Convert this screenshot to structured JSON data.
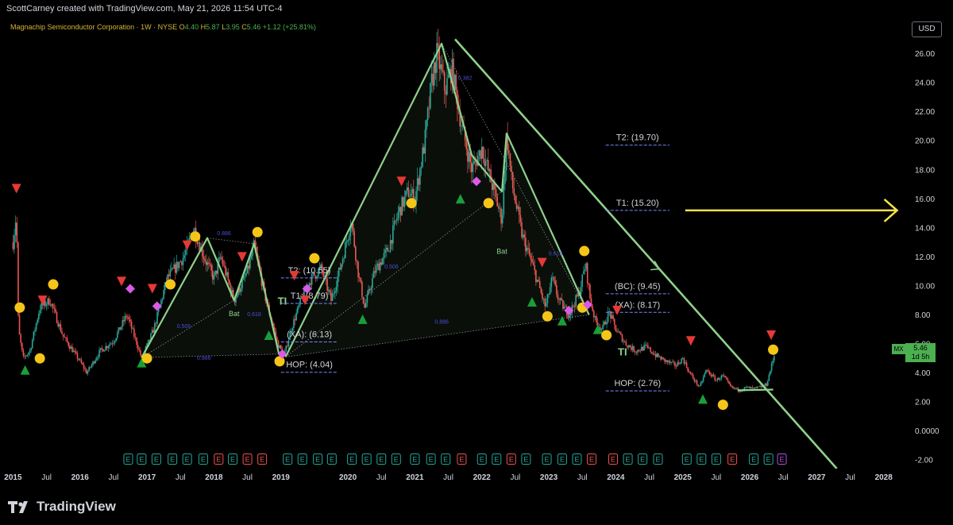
{
  "header": {
    "attribution": "ScottCarney created with TradingView.com, May 21, 2026 11:54 UTC-4"
  },
  "legend": {
    "title": "Magnachip Semiconductor Corporation · 1W · NYSE",
    "o_label": "O",
    "o_value": "4.40",
    "h_label": "H",
    "h_value": "5.87",
    "l_label": "L",
    "l_value": "3.95",
    "c_label": "C",
    "c_value": "5.46",
    "change": "+1.12 (+25.81%)"
  },
  "currency_button": "USD",
  "price_tag": {
    "symbol": "MX",
    "price": "5.46",
    "countdown": "1d 5h"
  },
  "footer": {
    "brand": "TradingView"
  },
  "colors": {
    "up": "#26a69a",
    "down": "#ef5350",
    "pattern": "#8fd18a",
    "arrow": "#f3e24a",
    "bull_marker": "#1b9e3a",
    "bear_marker": "#e53935",
    "circle": "#f5c518",
    "diamond": "#d95ae6"
  },
  "chart_data": {
    "type": "candlestick",
    "x_ticks": [
      "2015",
      "Jul",
      "2016",
      "Jul",
      "2017",
      "Jul",
      "2018",
      "Jul",
      "2019",
      "2020",
      "Jul",
      "2021",
      "Jul",
      "2022",
      "Jul",
      "2023",
      "Jul",
      "2024",
      "Jul",
      "2025",
      "Jul",
      "2026",
      "Jul",
      "2027",
      "Jul",
      "2028"
    ],
    "x_tick_years": [
      2015.0,
      2015.5,
      2016.0,
      2016.5,
      2017.0,
      2017.5,
      2018.0,
      2018.5,
      2019.0,
      2020.0,
      2020.5,
      2021.0,
      2021.5,
      2022.0,
      2022.5,
      2023.0,
      2023.5,
      2024.0,
      2024.5,
      2025.0,
      2025.5,
      2026.0,
      2026.5,
      2027.0,
      2027.5,
      2028.0
    ],
    "y_ticks": [
      "26.00",
      "24.00",
      "22.00",
      "20.00",
      "18.00",
      "16.00",
      "14.00",
      "12.00",
      "10.00",
      "8.00",
      "6.00",
      "4.00",
      "2.00",
      "0.0000",
      "-2.00"
    ],
    "y_tick_values": [
      26,
      24,
      22,
      20,
      18,
      16,
      14,
      12,
      10,
      8,
      6,
      4,
      2,
      0,
      -2
    ],
    "ylim": [
      -2.6,
      28.5
    ],
    "xlim": [
      2014.9,
      2028.3
    ],
    "price_path": [
      [
        2015.0,
        13.0
      ],
      [
        2015.05,
        15.0
      ],
      [
        2015.08,
        7.0
      ],
      [
        2015.15,
        5.0
      ],
      [
        2015.25,
        5.5
      ],
      [
        2015.4,
        8.5
      ],
      [
        2015.55,
        9.0
      ],
      [
        2015.75,
        6.5
      ],
      [
        2016.0,
        4.8
      ],
      [
        2016.1,
        4.0
      ],
      [
        2016.3,
        5.5
      ],
      [
        2016.5,
        6.2
      ],
      [
        2016.7,
        8.0
      ],
      [
        2016.85,
        6.0
      ],
      [
        2016.92,
        5.0
      ],
      [
        2017.1,
        7.0
      ],
      [
        2017.3,
        10.5
      ],
      [
        2017.55,
        12.0
      ],
      [
        2017.7,
        14.0
      ],
      [
        2017.85,
        12.0
      ],
      [
        2018.0,
        10.5
      ],
      [
        2018.1,
        12.0
      ],
      [
        2018.3,
        9.0
      ],
      [
        2018.5,
        11.0
      ],
      [
        2018.6,
        12.8
      ],
      [
        2018.75,
        9.5
      ],
      [
        2018.95,
        6.0
      ],
      [
        2019.05,
        5.2
      ],
      [
        2019.15,
        7.0
      ],
      [
        2019.3,
        9.0
      ],
      [
        2019.45,
        10.5
      ],
      [
        2019.6,
        11.2
      ],
      [
        2019.75,
        9.0
      ],
      [
        2019.9,
        11.5
      ],
      [
        2020.05,
        14.5
      ],
      [
        2020.15,
        11.0
      ],
      [
        2020.25,
        8.5
      ],
      [
        2020.4,
        11.0
      ],
      [
        2020.6,
        12.5
      ],
      [
        2020.75,
        15.0
      ],
      [
        2020.9,
        16.5
      ],
      [
        2021.0,
        16.0
      ],
      [
        2021.15,
        20.0
      ],
      [
        2021.25,
        24.0
      ],
      [
        2021.33,
        26.0
      ],
      [
        2021.45,
        23.5
      ],
      [
        2021.55,
        25.0
      ],
      [
        2021.7,
        21.0
      ],
      [
        2021.85,
        18.0
      ],
      [
        2022.0,
        19.5
      ],
      [
        2022.15,
        17.0
      ],
      [
        2022.3,
        14.5
      ],
      [
        2022.37,
        20.5
      ],
      [
        2022.45,
        17.0
      ],
      [
        2022.6,
        13.5
      ],
      [
        2022.75,
        11.5
      ],
      [
        2022.85,
        10.0
      ],
      [
        2022.95,
        8.5
      ],
      [
        2023.05,
        10.5
      ],
      [
        2023.15,
        9.0
      ],
      [
        2023.3,
        8.0
      ],
      [
        2023.45,
        9.5
      ],
      [
        2023.55,
        11.5
      ],
      [
        2023.62,
        9.0
      ],
      [
        2023.7,
        7.5
      ],
      [
        2023.8,
        7.0
      ],
      [
        2023.9,
        8.2
      ],
      [
        2024.0,
        7.0
      ],
      [
        2024.15,
        6.0
      ],
      [
        2024.3,
        5.5
      ],
      [
        2024.45,
        5.8
      ],
      [
        2024.6,
        5.2
      ],
      [
        2024.75,
        4.8
      ],
      [
        2024.9,
        4.5
      ],
      [
        2025.0,
        5.0
      ],
      [
        2025.1,
        4.0
      ],
      [
        2025.25,
        3.0
      ],
      [
        2025.35,
        4.2
      ],
      [
        2025.5,
        3.5
      ],
      [
        2025.6,
        3.8
      ],
      [
        2025.72,
        3.0
      ],
      [
        2025.85,
        2.8
      ],
      [
        2025.95,
        3.0
      ],
      [
        2026.05,
        2.9
      ],
      [
        2026.15,
        3.0
      ],
      [
        2026.25,
        3.2
      ],
      [
        2026.32,
        4.4
      ],
      [
        2026.38,
        5.46
      ]
    ],
    "pattern_lines": [
      [
        [
          2016.92,
          5.05
        ],
        [
          2017.9,
          13.3
        ],
        [
          2018.3,
          9.0
        ],
        [
          2018.6,
          12.9
        ],
        [
          2018.97,
          5.3
        ]
      ],
      [
        [
          2019.07,
          5.1
        ],
        [
          2021.4,
          26.7
        ],
        [
          2021.85,
          19.0
        ],
        [
          2022.3,
          16.5
        ],
        [
          2022.37,
          20.5
        ],
        [
          2023.6,
          8.0
        ]
      ],
      [
        [
          2025.82,
          2.8
        ],
        [
          2026.35,
          2.85
        ]
      ]
    ],
    "dotted_lines": [
      [
        [
          2016.92,
          5.05
        ],
        [
          2018.97,
          5.3
        ]
      ],
      [
        [
          2016.92,
          5.05
        ],
        [
          2018.3,
          9.0
        ]
      ],
      [
        [
          2017.9,
          13.3
        ],
        [
          2018.6,
          12.9
        ]
      ],
      [
        [
          2019.07,
          5.1
        ],
        [
          2022.3,
          16.5
        ]
      ],
      [
        [
          2019.07,
          5.1
        ],
        [
          2023.6,
          8.0
        ]
      ],
      [
        [
          2021.4,
          26.7
        ],
        [
          2023.6,
          8.0
        ]
      ]
    ],
    "trendline": [
      [
        2021.6,
        27.0
      ],
      [
        2027.3,
        -2.6
      ]
    ],
    "xabcd_ratios": [
      {
        "label": "0.886",
        "x": 2018.15,
        "y": 13.5
      },
      {
        "label": "0.506",
        "x": 2017.55,
        "y": 7.1
      },
      {
        "label": "0.618",
        "x": 2018.6,
        "y": 7.9
      },
      {
        "label": "0.886",
        "x": 2017.85,
        "y": 4.9
      },
      {
        "label": "0.382",
        "x": 2021.75,
        "y": 24.2
      },
      {
        "label": "0.506",
        "x": 2020.65,
        "y": 11.2
      },
      {
        "label": "0.618",
        "x": 2023.1,
        "y": 12.1
      },
      {
        "label": "0.886",
        "x": 2021.4,
        "y": 7.4
      }
    ],
    "pattern_names": [
      {
        "label": "Bat",
        "x": 2018.3,
        "y": 7.9
      },
      {
        "label": "Bat",
        "x": 2022.3,
        "y": 12.2
      }
    ],
    "trade_markers": [
      {
        "label": "TI",
        "x": 2019.02,
        "y": 8.7
      },
      {
        "label": "TI",
        "x": 2024.1,
        "y": 5.2
      }
    ],
    "levels": [
      {
        "label": "T2: (10.55)",
        "value": 10.55,
        "x0": 2019.0,
        "x1": 2019.85
      },
      {
        "label": "T1: (8.79)",
        "value": 8.79,
        "x0": 2019.0,
        "x1": 2019.85
      },
      {
        "label": "(XA): (6.13)",
        "value": 6.13,
        "x0": 2019.0,
        "x1": 2019.85
      },
      {
        "label": "HOP: (4.04)",
        "value": 4.04,
        "x0": 2019.0,
        "x1": 2019.85
      },
      {
        "label": "T2: (19.70)",
        "value": 19.7,
        "x0": 2023.85,
        "x1": 2024.8
      },
      {
        "label": "T1: (15.20)",
        "value": 15.2,
        "x0": 2023.85,
        "x1": 2024.8
      },
      {
        "label": "(BC): (9.45)",
        "value": 9.45,
        "x0": 2023.85,
        "x1": 2024.8
      },
      {
        "label": "(XA): (8.17)",
        "value": 8.17,
        "x0": 2023.85,
        "x1": 2024.8
      },
      {
        "label": "HOP: (2.76)",
        "value": 2.76,
        "x0": 2023.85,
        "x1": 2024.8
      }
    ],
    "projection_arrow": {
      "x0": 2024.8,
      "x1": 2028.2,
      "value": 15.2
    },
    "bull_markers": [
      [
        2015.18,
        4.2
      ],
      [
        2016.92,
        4.7
      ],
      [
        2018.82,
        6.6
      ],
      [
        2020.22,
        7.7
      ],
      [
        2021.68,
        16.0
      ],
      [
        2022.75,
        8.9
      ],
      [
        2023.2,
        7.6
      ],
      [
        2023.73,
        7.0
      ],
      [
        2025.3,
        2.2
      ]
    ],
    "bear_markers": [
      [
        2015.05,
        16.7
      ],
      [
        2015.44,
        9.0
      ],
      [
        2016.62,
        10.3
      ],
      [
        2017.08,
        9.8
      ],
      [
        2017.6,
        12.8
      ],
      [
        2018.42,
        12.0
      ],
      [
        2019.2,
        10.7
      ],
      [
        2019.36,
        9.0
      ],
      [
        2020.8,
        17.2
      ],
      [
        2022.9,
        11.6
      ],
      [
        2024.02,
        8.3
      ],
      [
        2025.12,
        6.2
      ],
      [
        2026.32,
        6.6
      ]
    ],
    "circles": [
      [
        2015.1,
        8.5
      ],
      [
        2015.4,
        5.0
      ],
      [
        2015.6,
        10.1
      ],
      [
        2017.0,
        5.0
      ],
      [
        2017.35,
        10.1
      ],
      [
        2017.72,
        13.4
      ],
      [
        2018.65,
        13.7
      ],
      [
        2018.98,
        4.8
      ],
      [
        2019.5,
        11.9
      ],
      [
        2020.95,
        15.7
      ],
      [
        2022.1,
        15.7
      ],
      [
        2022.98,
        7.9
      ],
      [
        2023.53,
        12.4
      ],
      [
        2023.5,
        8.5
      ],
      [
        2023.86,
        6.6
      ],
      [
        2025.6,
        1.8
      ],
      [
        2026.35,
        5.6
      ]
    ],
    "diamonds": [
      [
        2016.75,
        9.8
      ],
      [
        2017.15,
        8.6
      ],
      [
        2019.02,
        5.3
      ],
      [
        2019.39,
        9.8
      ],
      [
        2021.92,
        17.2
      ],
      [
        2023.3,
        8.3
      ],
      [
        2023.58,
        8.7
      ]
    ],
    "earnings": [
      {
        "x": 2016.72,
        "type": "E"
      },
      {
        "x": 2016.92,
        "type": "E"
      },
      {
        "x": 2017.14,
        "type": "E"
      },
      {
        "x": 2017.38,
        "type": "E"
      },
      {
        "x": 2017.6,
        "type": "E"
      },
      {
        "x": 2017.84,
        "type": "E"
      },
      {
        "x": 2018.07,
        "type": "E"
      },
      {
        "x": 2018.28,
        "type": "E"
      },
      {
        "x": 2018.5,
        "type": "E"
      },
      {
        "x": 2018.72,
        "type": "E"
      },
      {
        "x": 2019.1,
        "type": "E"
      },
      {
        "x": 2019.32,
        "type": "E"
      },
      {
        "x": 2019.55,
        "type": "E"
      },
      {
        "x": 2019.76,
        "type": "E"
      },
      {
        "x": 2020.06,
        "type": "E"
      },
      {
        "x": 2020.28,
        "type": "E"
      },
      {
        "x": 2020.5,
        "type": "E"
      },
      {
        "x": 2020.72,
        "type": "E"
      },
      {
        "x": 2021.0,
        "type": "E"
      },
      {
        "x": 2021.24,
        "type": "E"
      },
      {
        "x": 2021.46,
        "type": "E"
      },
      {
        "x": 2021.7,
        "type": "E"
      },
      {
        "x": 2022.0,
        "type": "E"
      },
      {
        "x": 2022.22,
        "type": "E"
      },
      {
        "x": 2022.44,
        "type": "E"
      },
      {
        "x": 2022.66,
        "type": "E"
      },
      {
        "x": 2022.97,
        "type": "E"
      },
      {
        "x": 2023.2,
        "type": "E"
      },
      {
        "x": 2023.42,
        "type": "E"
      },
      {
        "x": 2023.64,
        "type": "E"
      },
      {
        "x": 2023.96,
        "type": "E"
      },
      {
        "x": 2024.18,
        "type": "E"
      },
      {
        "x": 2024.4,
        "type": "E"
      },
      {
        "x": 2024.63,
        "type": "E"
      },
      {
        "x": 2025.06,
        "type": "E"
      },
      {
        "x": 2025.28,
        "type": "E"
      },
      {
        "x": 2025.5,
        "type": "E"
      },
      {
        "x": 2025.74,
        "type": "E"
      },
      {
        "x": 2026.06,
        "type": "E"
      },
      {
        "x": 2026.28,
        "type": "E"
      },
      {
        "x": 2026.48,
        "type": "E"
      }
    ],
    "earnings_red_index": [
      6,
      8,
      9,
      21,
      24,
      29,
      30,
      37
    ],
    "earnings_purple_index": [
      40
    ]
  }
}
